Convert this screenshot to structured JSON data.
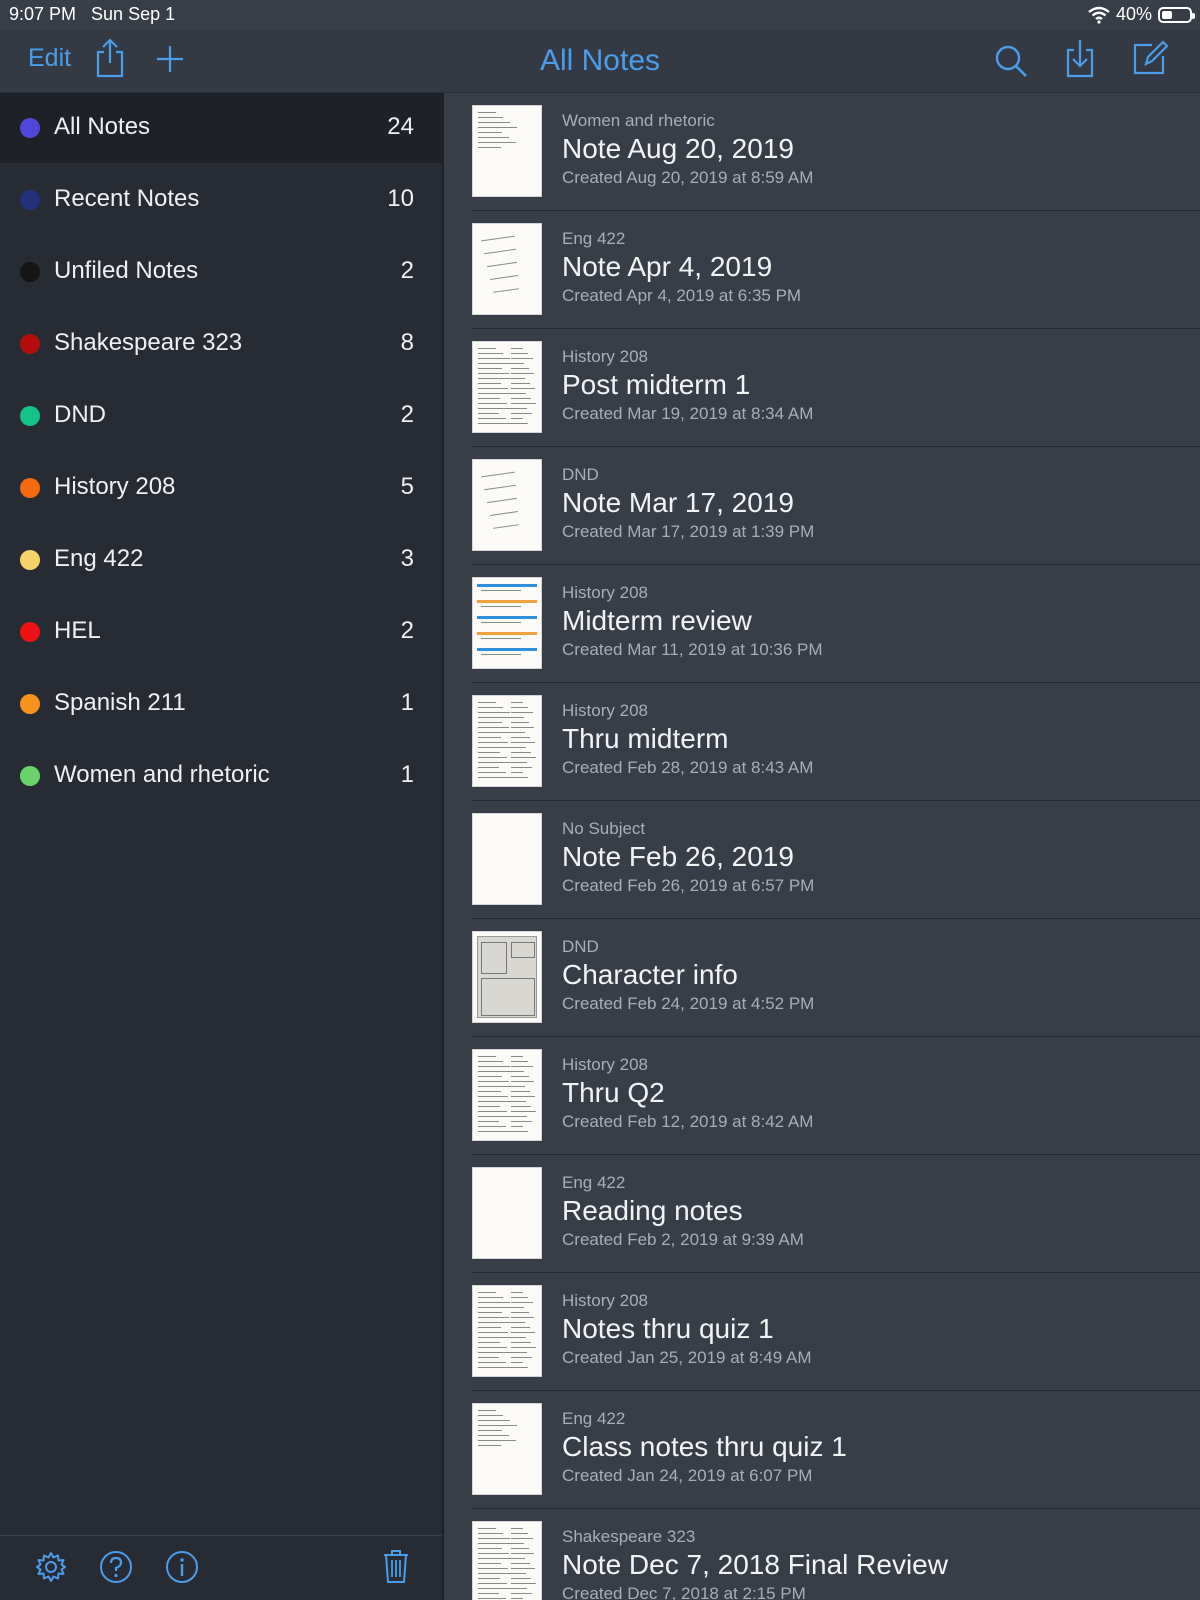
{
  "status_bar": {
    "time": "9:07 PM   Sun Sep 1",
    "battery": "40%",
    "battery_level": 0.4
  },
  "navbar": {
    "edit_label": "Edit",
    "title": "All Notes",
    "left_icons": [
      "share-icon",
      "plus-icon"
    ],
    "right_icons": [
      "search-icon",
      "import-icon",
      "compose-icon"
    ],
    "accent_color": "#4a9de8"
  },
  "sidebar": {
    "items": [
      {
        "label": "All Notes",
        "count": "24",
        "color": "#5046d8",
        "selected": true
      },
      {
        "label": "Recent Notes",
        "count": "10",
        "color": "#22317a"
      },
      {
        "label": "Unfiled Notes",
        "count": "2",
        "color": "#151515"
      },
      {
        "label": "Shakespeare 323",
        "count": "8",
        "color": "#b30d0d"
      },
      {
        "label": "DND",
        "count": "2",
        "color": "#16c08a"
      },
      {
        "label": "History 208",
        "count": "5",
        "color": "#f26a10"
      },
      {
        "label": "Eng 422",
        "count": "3",
        "color": "#f5d36a"
      },
      {
        "label": "HEL",
        "count": "2",
        "color": "#ee1111"
      },
      {
        "label": "Spanish 211",
        "count": "1",
        "color": "#f7931e"
      },
      {
        "label": "Women and rhetoric",
        "count": "1",
        "color": "#68d36a"
      }
    ],
    "footer_icons": [
      "gear-icon",
      "help-icon",
      "info-icon",
      "trash-icon"
    ]
  },
  "notes": [
    {
      "subject": "Women and rhetoric",
      "title": "Note Aug 20, 2019",
      "created": "Created Aug 20, 2019 at 8:59 AM",
      "thumb": "lines"
    },
    {
      "subject": "Eng 422",
      "title": "Note Apr 4, 2019",
      "created": "Created Apr 4, 2019 at 6:35 PM",
      "thumb": "handwriting"
    },
    {
      "subject": "History 208",
      "title": "Post midterm 1",
      "created": "Created Mar 19, 2019 at 8:34 AM",
      "thumb": "dense"
    },
    {
      "subject": "DND",
      "title": "Note Mar 17, 2019",
      "created": "Created Mar 17, 2019 at 1:39 PM",
      "thumb": "handwriting"
    },
    {
      "subject": "History 208",
      "title": "Midterm review",
      "created": "Created Mar 11, 2019 at 10:36 PM",
      "thumb": "colored"
    },
    {
      "subject": "History 208",
      "title": "Thru midterm",
      "created": "Created Feb 28, 2019 at 8:43 AM",
      "thumb": "dense"
    },
    {
      "subject": "No Subject",
      "title": "Note Feb 26, 2019",
      "created": "Created Feb 26, 2019 at 6:57 PM",
      "thumb": "blank"
    },
    {
      "subject": "DND",
      "title": "Character info",
      "created": "Created Feb 24, 2019 at 4:52 PM",
      "thumb": "sheet"
    },
    {
      "subject": "History 208",
      "title": "Thru Q2",
      "created": "Created Feb 12, 2019 at 8:42 AM",
      "thumb": "dense"
    },
    {
      "subject": "Eng 422",
      "title": "Reading notes",
      "created": "Created Feb 2, 2019 at 9:39 AM",
      "thumb": "blank"
    },
    {
      "subject": "History 208",
      "title": "Notes thru quiz 1",
      "created": "Created Jan 25, 2019 at 8:49 AM",
      "thumb": "dense"
    },
    {
      "subject": "Eng 422",
      "title": "Class notes thru quiz 1",
      "created": "Created Jan 24, 2019 at 6:07 PM",
      "thumb": "lines"
    },
    {
      "subject": "Shakespeare 323",
      "title": "Note Dec 7, 2018 Final Review",
      "created": "Created Dec 7, 2018 at 2:15 PM",
      "thumb": "dense"
    }
  ]
}
